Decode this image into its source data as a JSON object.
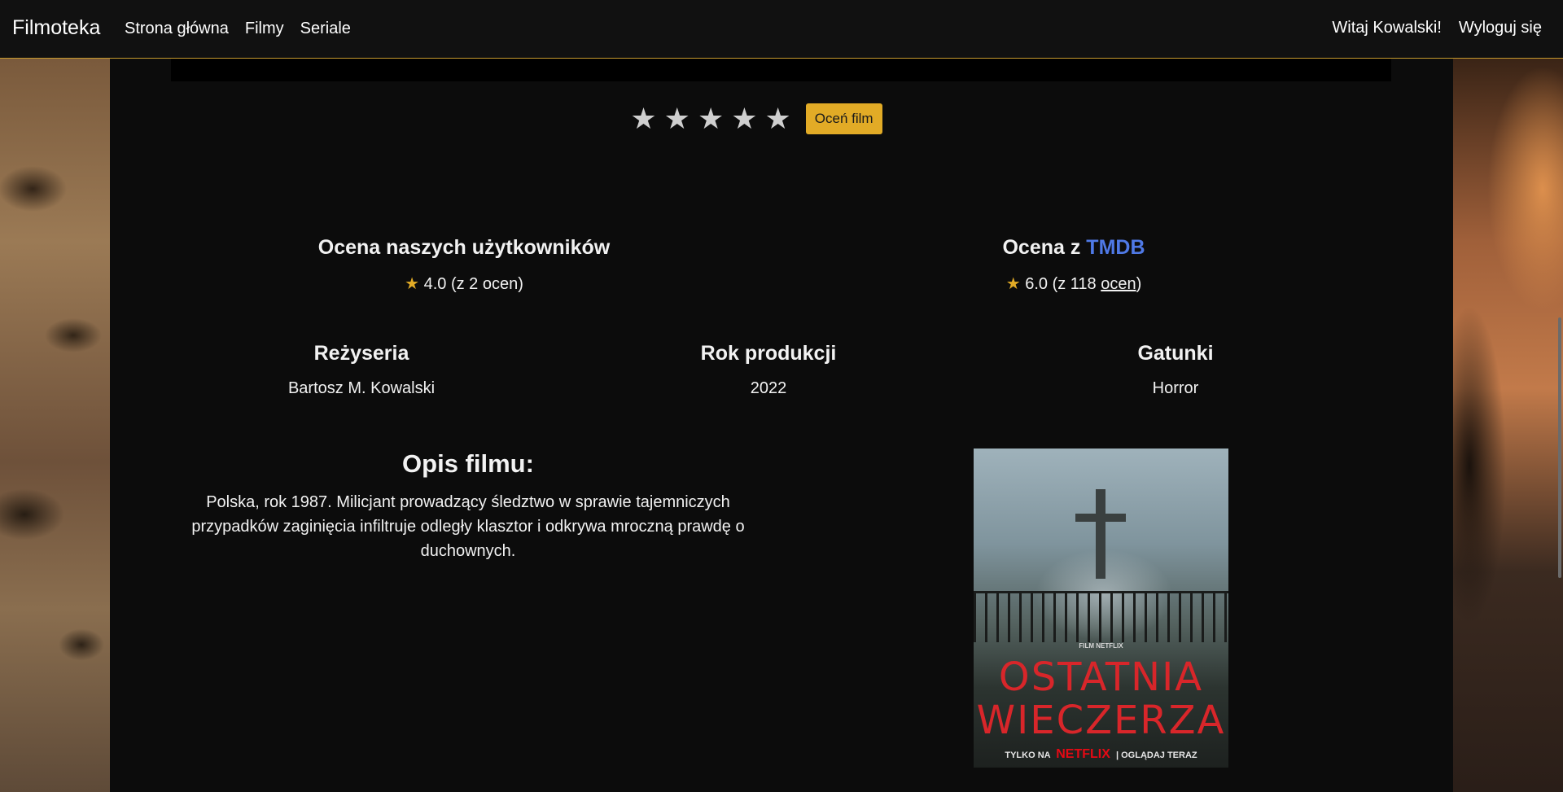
{
  "navbar": {
    "brand": "Filmoteka",
    "links": [
      "Strona główna",
      "Filmy",
      "Seriale"
    ],
    "greeting": "Witaj Kowalski!",
    "logout": "Wyloguj się"
  },
  "rating": {
    "stars": [
      "★",
      "★",
      "★",
      "★",
      "★"
    ],
    "button": "Oceń film"
  },
  "scores": {
    "users": {
      "title": "Ocena naszych użytkowników",
      "star": "★",
      "value": "4.0 (z 2 ocen)"
    },
    "tmdb": {
      "title_prefix": "Ocena z ",
      "title_link": "TMDB",
      "star": "★",
      "value": "6.0 (z 118 ",
      "value_link": "ocen",
      "value_suffix": ")"
    }
  },
  "info": {
    "director_title": "Reżyseria",
    "director": "Bartosz M. Kowalski",
    "year_title": "Rok produkcji",
    "year": "2022",
    "genre_title": "Gatunki",
    "genre": "Horror"
  },
  "description": {
    "title": "Opis filmu:",
    "text": "Polska, rok 1987. Milicjant prowadzący śledztwo w sprawie tajemniczych przypadków zaginięcia infiltruje odległy klasztor i odkrywa mroczną prawdę o duchownych."
  },
  "poster": {
    "small": "FILM NETFLIX",
    "title_line1": "OSTATNIA",
    "title_line2": "WIECZERZA",
    "bottom_left": "TYLKO NA",
    "bottom_brand": "NETFLIX",
    "bottom_sep": "|",
    "bottom_right": "OGLĄDAJ TERAZ"
  },
  "colors": {
    "accent": "#e2ab26",
    "link": "#4f79e6",
    "background": "#0c0c0c"
  }
}
